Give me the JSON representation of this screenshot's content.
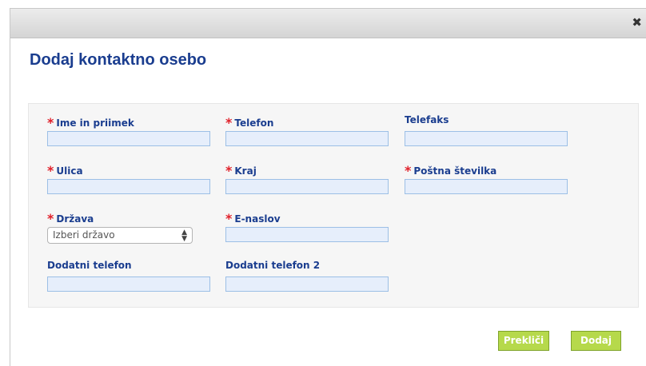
{
  "dialog": {
    "title": "Dodaj kontaktno osebo",
    "close_icon": "close-icon"
  },
  "form": {
    "required_marker": "*",
    "fields": {
      "name": {
        "label": "Ime in priimek",
        "required": true,
        "value": ""
      },
      "phone": {
        "label": "Telefon",
        "required": true,
        "value": ""
      },
      "fax": {
        "label": "Telefaks",
        "required": false,
        "value": ""
      },
      "street": {
        "label": "Ulica",
        "required": true,
        "value": ""
      },
      "city": {
        "label": "Kraj",
        "required": true,
        "value": ""
      },
      "postal_code": {
        "label": "Poštna številka",
        "required": true,
        "value": ""
      },
      "country": {
        "label": "Država",
        "required": true,
        "selected": "Izberi državo"
      },
      "email": {
        "label": "E-naslov",
        "required": true,
        "value": ""
      },
      "additional_phone": {
        "label": "Dodatni telefon",
        "required": false,
        "value": ""
      },
      "additional_phone_2": {
        "label": "Dodatni telefon 2",
        "required": false,
        "value": ""
      }
    }
  },
  "buttons": {
    "cancel": "Prekliči",
    "add": "Dodaj"
  },
  "colors": {
    "heading": "#1a3d8f",
    "required": "#e0202a",
    "button": "#b6d94b",
    "input_bg": "#e6eefb"
  }
}
